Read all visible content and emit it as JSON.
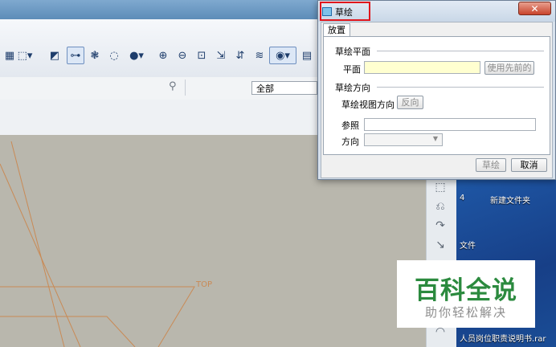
{
  "dialog": {
    "title": "草绘",
    "close_label": "✕",
    "tab_placement": "放置",
    "sketch_plane_section": "草绘平面",
    "plane_label": "平面",
    "plane_value": "",
    "use_previous_button": "使用先前的",
    "sketch_orientation_section": "草绘方向",
    "view_direction_label": "草绘视图方向",
    "flip_button": "反向",
    "reference_label": "参照",
    "reference_value": "",
    "orientation_label": "方向",
    "orientation_value": "",
    "sketch_button": "草绘",
    "cancel_button": "取消"
  },
  "toolbar": {
    "filter_value": "全部"
  },
  "graphics": {
    "datum_label": "TOP"
  },
  "desktop": {
    "item_new_folder": "新建文件夹",
    "item_partial_4": "4",
    "item_file": "文件",
    "item_rar": "人员岗位职责说明书.rar"
  },
  "watermark": {
    "title": "百科全说",
    "subtitle": "助你轻松解决"
  },
  "colors": {
    "highlight": "#e0161c",
    "plane_field_bg": "#ffffd0",
    "datum_line": "#c98a55",
    "watermark_green": "#2b8a3e"
  }
}
